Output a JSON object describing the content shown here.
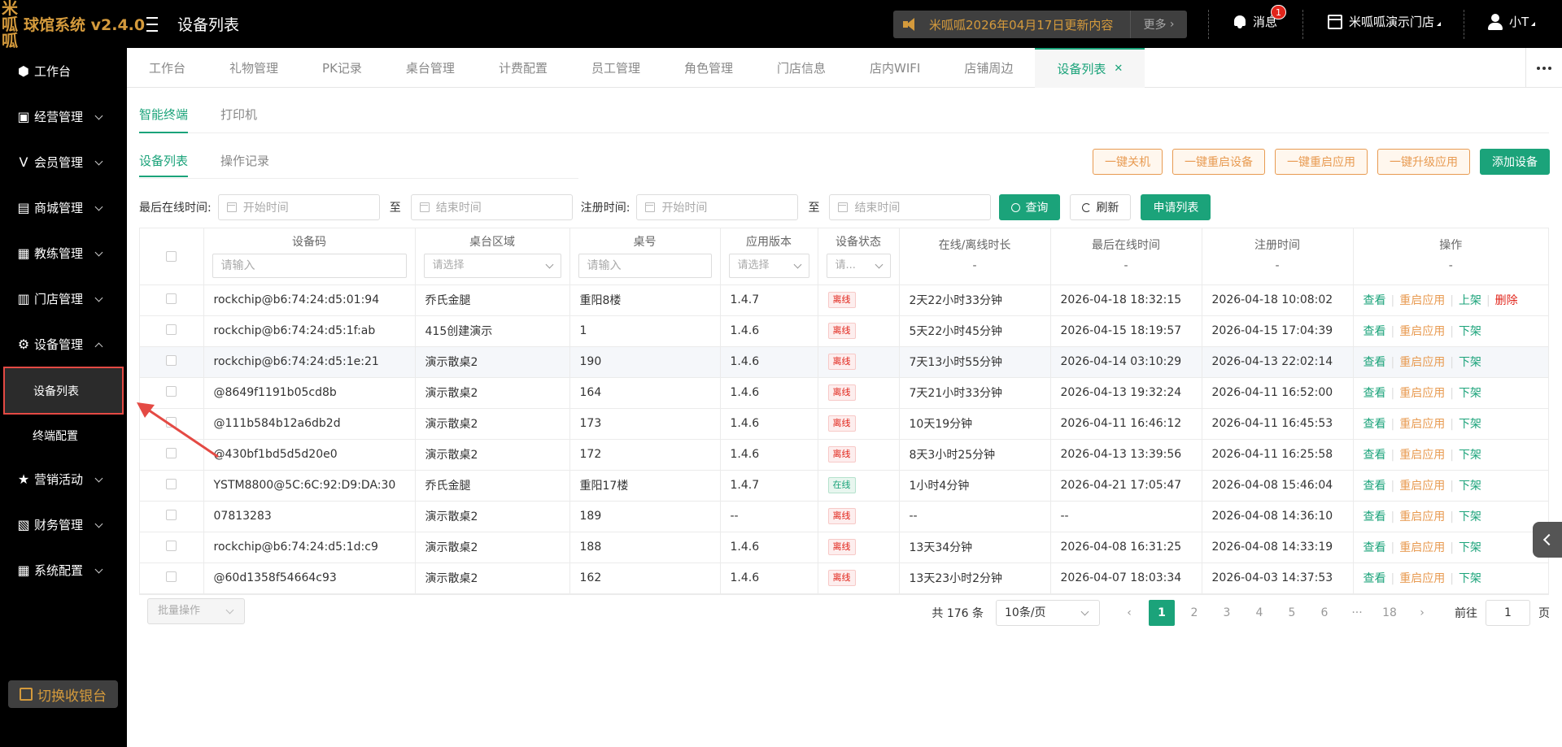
{
  "header": {
    "logo_text": "米呱呱",
    "brand": "球馆系统 v2.4.0",
    "page_title": "设备列表",
    "notice": "米呱呱2026年04月17日更新内容",
    "notice_more": "更多",
    "messages_label": "消息",
    "messages_badge": "1",
    "store_name": "米呱呱演示门店",
    "user_name": "小T"
  },
  "sidebar": {
    "items": [
      {
        "label": "工作台",
        "icon": "cube-icon"
      },
      {
        "label": "经营管理",
        "icon": "shop-icon"
      },
      {
        "label": "会员管理",
        "icon": "vip-icon"
      },
      {
        "label": "商城管理",
        "icon": "mall-icon"
      },
      {
        "label": "教练管理",
        "icon": "coach-icon"
      },
      {
        "label": "门店管理",
        "icon": "store-icon"
      },
      {
        "label": "设备管理",
        "icon": "device-icon"
      },
      {
        "label": "营销活动",
        "icon": "star-icon"
      },
      {
        "label": "财务管理",
        "icon": "finance-icon"
      },
      {
        "label": "系统配置",
        "icon": "grid-icon"
      }
    ],
    "sub_items": [
      "设备列表",
      "终端配置"
    ],
    "switch_label": "切换收银台"
  },
  "tabs": [
    "工作台",
    "礼物管理",
    "PK记录",
    "桌台管理",
    "计费配置",
    "员工管理",
    "角色管理",
    "门店信息",
    "店内WIFI",
    "店铺周边",
    "设备列表"
  ],
  "subtabs": [
    "智能终端",
    "打印机"
  ],
  "subtabs2": [
    "设备列表",
    "操作记录"
  ],
  "actions": [
    "一键关机",
    "一键重启设备",
    "一键重启应用",
    "一键升级应用",
    "添加设备"
  ],
  "filters": {
    "last_online_label": "最后在线时间:",
    "register_label": "注册时间:",
    "start_placeholder": "开始时间",
    "end_placeholder": "结束时间",
    "to": "至",
    "query": "查询",
    "refresh": "刷新",
    "apply_list": "申请列表"
  },
  "table": {
    "columns": [
      "设备码",
      "桌台区域",
      "桌号",
      "应用版本",
      "设备状态",
      "在线/离线时长",
      "最后在线时间",
      "注册时间",
      "操作"
    ],
    "input_placeholder": "请输入",
    "select_placeholder": "请选择",
    "status_select_placeholder": "请...",
    "dash": "-",
    "rows": [
      {
        "code": "rockchip@b6:74:24:d5:01:94",
        "area": "乔氏金腿",
        "table": "重阳8楼",
        "version": "1.4.7",
        "status": "离线",
        "duration": "2天22小时33分钟",
        "last_online": "2026-04-18 18:32:15",
        "registered": "2026-04-18 10:08:02",
        "ops": [
          "查看",
          "重启应用",
          "上架",
          "删除"
        ]
      },
      {
        "code": "rockchip@b6:74:24:d5:1f:ab",
        "area": "415创建演示",
        "table": "1",
        "version": "1.4.6",
        "status": "离线",
        "duration": "5天22小时45分钟",
        "last_online": "2026-04-15 18:19:57",
        "registered": "2026-04-15 17:04:39",
        "ops": [
          "查看",
          "重启应用",
          "下架"
        ]
      },
      {
        "code": "rockchip@b6:74:24:d5:1e:21",
        "area": "演示散桌2",
        "table": "190",
        "version": "1.4.6",
        "status": "离线",
        "duration": "7天13小时55分钟",
        "last_online": "2026-04-14 03:10:29",
        "registered": "2026-04-13 22:02:14",
        "ops": [
          "查看",
          "重启应用",
          "下架"
        ]
      },
      {
        "code": "@8649f1191b05cd8b",
        "area": "演示散桌2",
        "table": "164",
        "version": "1.4.6",
        "status": "离线",
        "duration": "7天21小时33分钟",
        "last_online": "2026-04-13 19:32:24",
        "registered": "2026-04-11 16:52:00",
        "ops": [
          "查看",
          "重启应用",
          "下架"
        ]
      },
      {
        "code": "@111b584b12a6db2d",
        "area": "演示散桌2",
        "table": "173",
        "version": "1.4.6",
        "status": "离线",
        "duration": "10天19分钟",
        "last_online": "2026-04-11 16:46:12",
        "registered": "2026-04-11 16:45:53",
        "ops": [
          "查看",
          "重启应用",
          "下架"
        ]
      },
      {
        "code": "@430bf1bd5d5d20e0",
        "area": "演示散桌2",
        "table": "172",
        "version": "1.4.6",
        "status": "离线",
        "duration": "8天3小时25分钟",
        "last_online": "2026-04-13 13:39:56",
        "registered": "2026-04-11 16:25:58",
        "ops": [
          "查看",
          "重启应用",
          "下架"
        ]
      },
      {
        "code": "YSTM8800@5C:6C:92:D9:DA:30",
        "area": "乔氏金腿",
        "table": "重阳17楼",
        "version": "1.4.7",
        "status": "在线",
        "duration": "1小时4分钟",
        "last_online": "2026-04-21 17:05:47",
        "registered": "2026-04-08 15:46:04",
        "ops": [
          "查看",
          "重启应用",
          "下架"
        ]
      },
      {
        "code": "07813283",
        "area": "演示散桌2",
        "table": "189",
        "version": "--",
        "status": "离线",
        "duration": "--",
        "last_online": "--",
        "registered": "2026-04-08 14:36:10",
        "ops": [
          "查看",
          "重启应用",
          "下架"
        ]
      },
      {
        "code": "rockchip@b6:74:24:d5:1d:c9",
        "area": "演示散桌2",
        "table": "188",
        "version": "1.4.6",
        "status": "离线",
        "duration": "13天34分钟",
        "last_online": "2026-04-08 16:31:25",
        "registered": "2026-04-08 14:33:19",
        "ops": [
          "查看",
          "重启应用",
          "下架"
        ]
      },
      {
        "code": "@60d1358f54664c93",
        "area": "演示散桌2",
        "table": "162",
        "version": "1.4.6",
        "status": "离线",
        "duration": "13天23小时2分钟",
        "last_online": "2026-04-07 18:03:34",
        "registered": "2026-04-03 14:37:53",
        "ops": [
          "查看",
          "重启应用",
          "下架"
        ]
      }
    ]
  },
  "pagination": {
    "batch_label": "批量操作",
    "total": "共 176 条",
    "page_size": "10条/页",
    "pages": [
      "1",
      "2",
      "3",
      "4",
      "5",
      "6",
      "···",
      "18"
    ],
    "current": "1",
    "goto_label": "前往",
    "goto_value": "1",
    "page_unit": "页"
  },
  "colors": {
    "accent": "#1ba37a",
    "brand_gold": "#d49a3c",
    "warning": "#e89b52",
    "danger": "#e1251b"
  }
}
